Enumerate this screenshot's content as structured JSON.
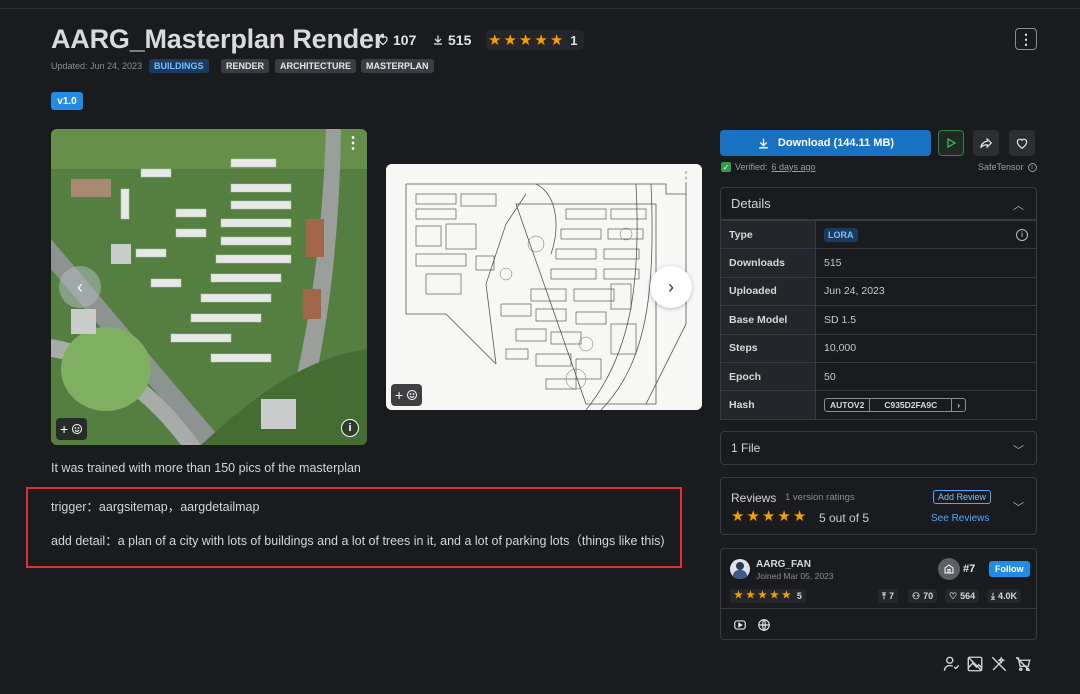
{
  "header": {
    "title": "AARG_Masterplan Render",
    "likes": "107",
    "downloads": "515",
    "rating_count": "1",
    "updated": "Updated: Jun 24, 2023",
    "tags": [
      "BUILDINGS",
      "RENDER",
      "ARCHITECTURE",
      "MASTERPLAN"
    ],
    "menu_glyph": "⋮"
  },
  "version": "v1.0",
  "gallery": {
    "prev_glyph": "‹",
    "next_glyph": "›",
    "more_glyph": "⋮"
  },
  "description": {
    "intro": "It was trained with more than 150 pics of the masterplan",
    "trigger": "trigger：aargsitemap，aargdetailmap",
    "add_detail": "add detail：a plan of a city with lots of buildings and a lot of trees in it, and a lot of parking lots（things like this)"
  },
  "download": {
    "label": "Download (144.11 MB)",
    "verified_prefix": "Verified:",
    "verified_when": "6 days ago",
    "safetensor": "SafeTensor"
  },
  "details": {
    "heading": "Details",
    "rows": {
      "type_label": "Type",
      "type_value": "LORA",
      "downloads_label": "Downloads",
      "downloads_value": "515",
      "uploaded_label": "Uploaded",
      "uploaded_value": "Jun 24, 2023",
      "base_label": "Base Model",
      "base_value": "SD 1.5",
      "steps_label": "Steps",
      "steps_value": "10,000",
      "epoch_label": "Epoch",
      "epoch_value": "50",
      "hash_label": "Hash",
      "hash_algo": "AUTOV2",
      "hash_value": "C935D2FA9C"
    }
  },
  "files": {
    "label": "1 File"
  },
  "reviews": {
    "heading": "Reviews",
    "ratings_note": "1 version ratings",
    "score": "5 out of 5",
    "add_label": "Add Review",
    "see_label": "See Reviews"
  },
  "creator": {
    "name": "AARG_FAN",
    "joined": "Joined Mar 05, 2023",
    "rank": "#7",
    "follow": "Follow",
    "rating": "5",
    "uploads": "7",
    "followers": "70",
    "likes": "564",
    "downloads": "4.0K"
  },
  "colors": {
    "accent": "#228be6",
    "download": "#1971c2",
    "star": "#f59f00",
    "highlight": "#e03131",
    "play": "#40c057",
    "tag_blue": "#74c0fc"
  }
}
